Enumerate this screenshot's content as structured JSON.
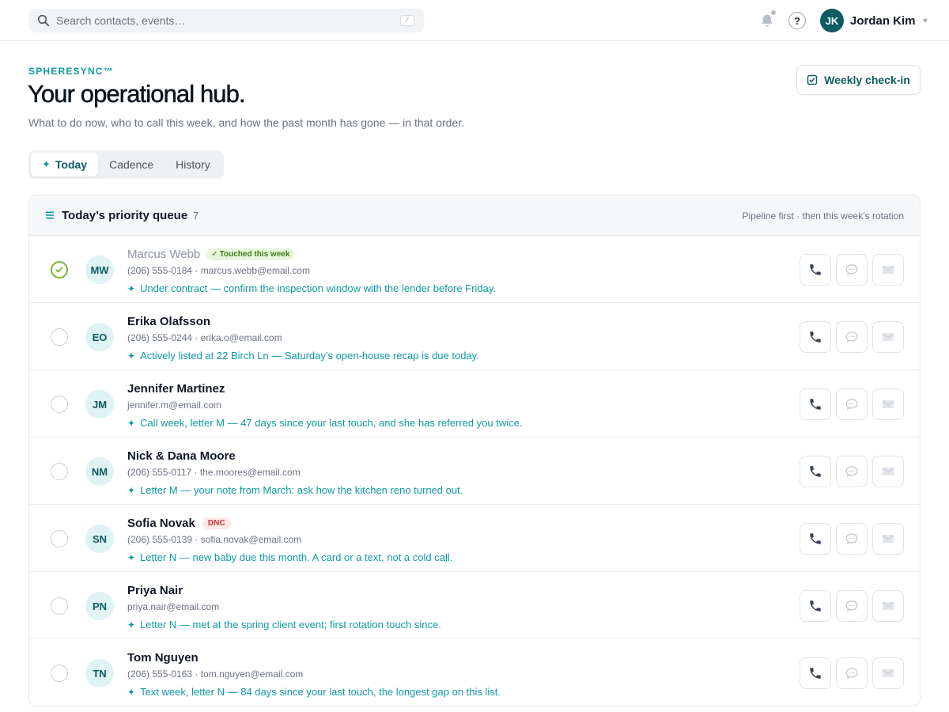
{
  "search": {
    "placeholder": "Search contacts, events…",
    "shortcut": "/"
  },
  "header_icons": [
    "bell-icon",
    "help-icon"
  ],
  "help_glyph": "?",
  "user": {
    "initials": "JK",
    "name": "Jordan Kim"
  },
  "brand": "SPHERESYNC™",
  "page": {
    "title": "Your operational hub.",
    "subtitle": "What to do now, who to call this week, and how the past month has gone — in that order."
  },
  "checkin_button": {
    "label": "Weekly check-in"
  },
  "tabs": [
    {
      "label": "Today",
      "active": true
    },
    {
      "label": "Cadence",
      "active": false
    },
    {
      "label": "History",
      "active": false
    }
  ],
  "queue": {
    "title": "Today’s priority queue",
    "count": "7",
    "note": "Pipeline first · then this week’s rotation",
    "items": [
      {
        "initials": "MW",
        "name": "Marcus Webb",
        "done": true,
        "badge": "Touched this week",
        "badge_type": "touched",
        "contact": "(206) 555-0184 · marcus.webb@email.com",
        "note": "Under contract — confirm the inspection window with the lender before Friday."
      },
      {
        "initials": "EO",
        "name": "Erika Olafsson",
        "done": false,
        "badge": "",
        "badge_type": "",
        "contact": "(206) 555-0244 · erika.o@email.com",
        "note": "Actively listed at 22 Birch Ln — Saturday’s open-house recap is due today."
      },
      {
        "initials": "JM",
        "name": "Jennifer Martinez",
        "done": false,
        "badge": "",
        "badge_type": "",
        "contact": "jennifer.m@email.com",
        "note": "Call week, letter M — 47 days since your last touch, and she has referred you twice."
      },
      {
        "initials": "NM",
        "name": "Nick & Dana Moore",
        "done": false,
        "badge": "",
        "badge_type": "",
        "contact": "(206) 555-0117 · the.moores@email.com",
        "note": "Letter M — your note from March: ask how the kitchen reno turned out."
      },
      {
        "initials": "SN",
        "name": "Sofia Novak",
        "done": false,
        "badge": "DNC",
        "badge_type": "dnc",
        "contact": "(206) 555-0139 · sofia.novak@email.com",
        "note": "Letter N — new baby due this month. A card or a text, not a cold call."
      },
      {
        "initials": "PN",
        "name": "Priya Nair",
        "done": false,
        "badge": "",
        "badge_type": "",
        "contact": "priya.nair@email.com",
        "note": "Letter N — met at the spring client event; first rotation touch since."
      },
      {
        "initials": "TN",
        "name": "Tom Nguyen",
        "done": false,
        "badge": "",
        "badge_type": "",
        "contact": "(206) 555-0163 · tom.nguyen@email.com",
        "note": "Text week, letter N — 84 days since your last touch, the longest gap on this list."
      }
    ]
  },
  "row_actions": [
    "phone-icon",
    "message-icon",
    "mail-icon"
  ],
  "colors": {
    "teal": "#0f9aa3",
    "teal_dark": "#0e5b63",
    "check_green": "#7ab52f",
    "dnc_red": "#d23030"
  }
}
